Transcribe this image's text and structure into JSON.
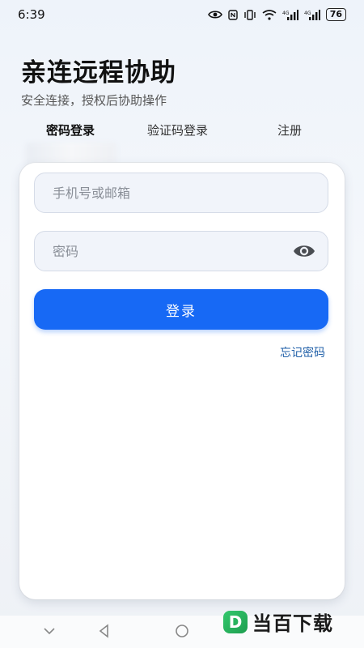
{
  "status_bar": {
    "time": "6:39",
    "battery": "76"
  },
  "header": {
    "title": "亲连远程协助",
    "subtitle": "安全连接，授权后协助操作"
  },
  "tabs": [
    {
      "label": "密码登录",
      "active": true
    },
    {
      "label": "验证码登录",
      "active": false
    },
    {
      "label": "注册",
      "active": false
    }
  ],
  "form": {
    "account_placeholder": "手机号或邮箱",
    "password_placeholder": "密码",
    "login_label": "登录",
    "forgot_label": "忘记密码"
  },
  "watermark": {
    "logo": "D",
    "text": "当百下载"
  },
  "colors": {
    "accent": "#1769f5",
    "link": "#1f5fa8"
  }
}
